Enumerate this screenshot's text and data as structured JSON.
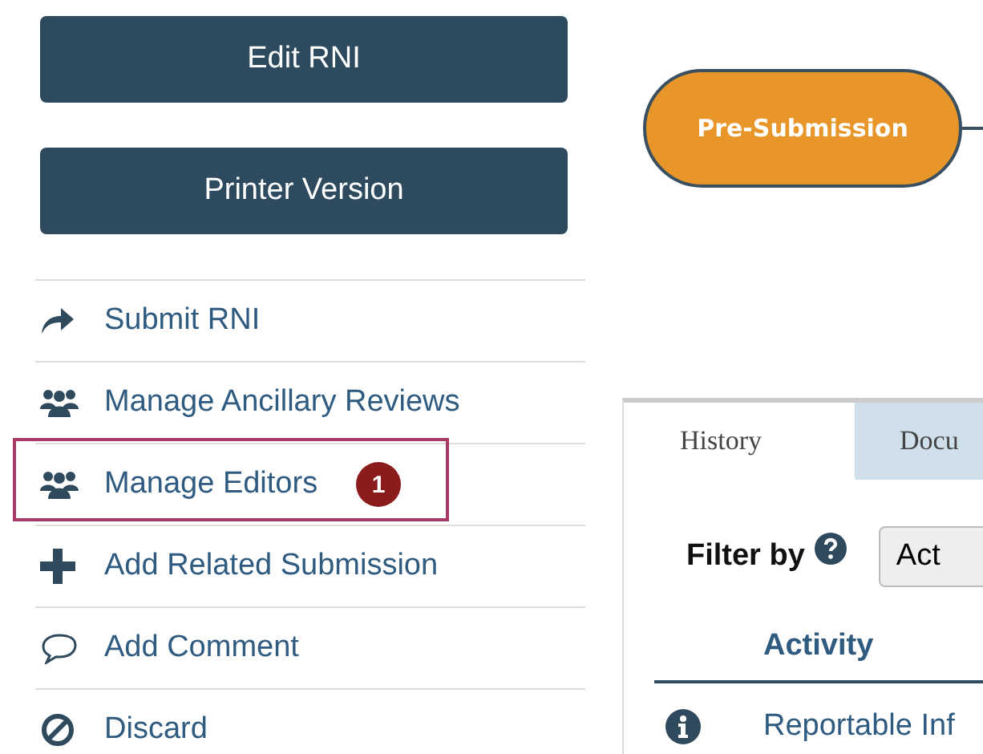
{
  "action_buttons": [
    "Edit RNI",
    "Printer Version"
  ],
  "menu_items": [
    {
      "label": "Submit RNI",
      "kind": "share",
      "highlighted": false
    },
    {
      "label": "Manage Ancillary Reviews",
      "kind": "group",
      "highlighted": false
    },
    {
      "label": "Manage Editors",
      "kind": "group",
      "highlighted": true,
      "callout": "1"
    },
    {
      "label": "Add Related Submission",
      "kind": "plus",
      "highlighted": false
    },
    {
      "label": "Add Comment",
      "kind": "comment",
      "highlighted": false
    },
    {
      "label": "Discard",
      "kind": "ban",
      "highlighted": false
    }
  ],
  "workflow": {
    "current_state": "Pre-Submission"
  },
  "tabs": [
    {
      "label": "History",
      "selected": true
    },
    {
      "label": "Docu",
      "selected": false
    }
  ],
  "filter": {
    "label": "Filter by",
    "value": "Act"
  },
  "table": {
    "columns": [
      "Activity"
    ],
    "rows": [
      {
        "activity": "Reportable Inf"
      }
    ]
  }
}
